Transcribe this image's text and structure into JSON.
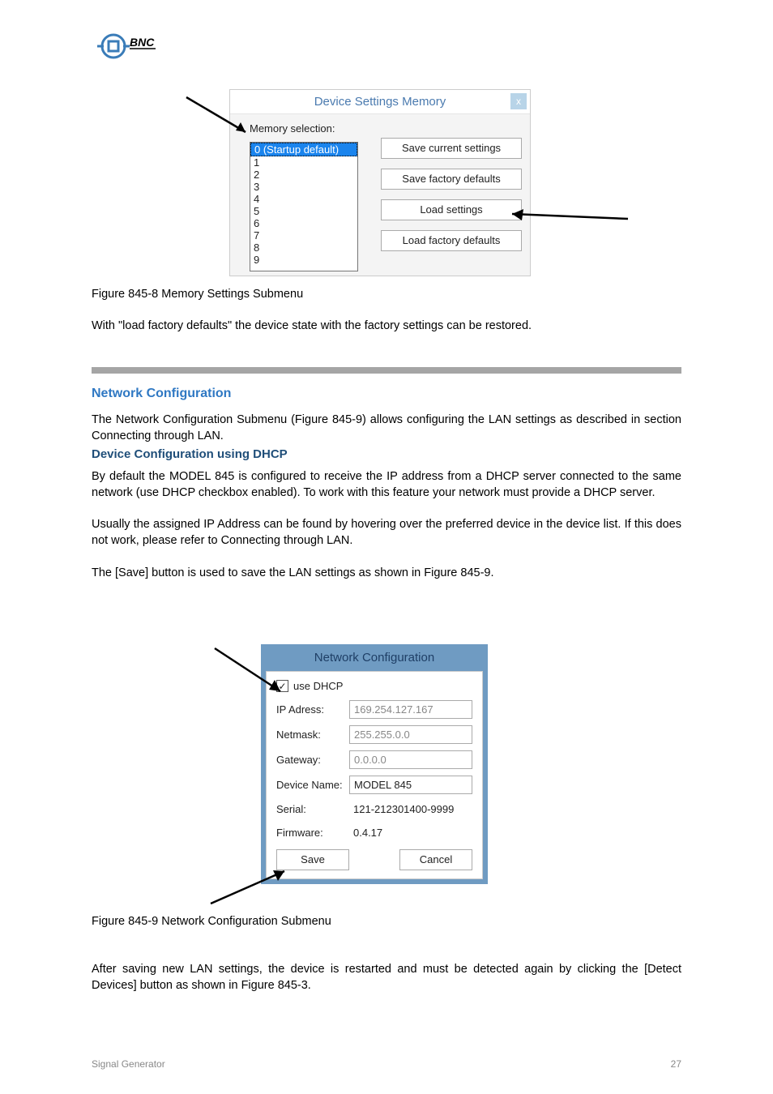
{
  "logo_text": "BNC",
  "dialog1": {
    "title": "Device Settings Memory",
    "close": "x",
    "mem_label": "Memory selection:",
    "items": [
      "0 (Startup default)",
      "1",
      "2",
      "3",
      "4",
      "5",
      "6",
      "7",
      "8",
      "9"
    ],
    "btn_save_current": "Save current settings",
    "btn_save_factory": "Save factory defaults",
    "btn_load": "Load settings",
    "btn_load_factory": "Load factory defaults"
  },
  "body": {
    "p1": "Figure 845-8 Memory Settings Submenu",
    "p2": "With \"load factory defaults\" the device state with the factory settings can be restored.",
    "section_title": "Network Configuration",
    "pA": "The Network Configuration Submenu (Figure 845-9) allows configuring the LAN settings as described in section Connecting through LAN.",
    "sub1": "Device Configuration using DHCP",
    "pB": "By default the MODEL 845 is configured to receive the IP address from a DHCP server connected to the same network (use DHCP checkbox enabled). To work with this feature your network must provide a DHCP server.",
    "pC": "Usually the assigned IP Address can be found by hovering over the preferred device in the device list. If this does not work, please refer to  Connecting through LAN.",
    "pD": "The [Save] button is used to save the LAN settings as shown in Figure 845-9.",
    "pE": "Figure 845-9 Network Configuration Submenu",
    "pF": "After saving new LAN settings, the device is restarted and must be detected again by clicking the [Detect Devices] button as shown in Figure 845-3."
  },
  "dialog2": {
    "title": "Network Configuration",
    "use_dhcp_label": "use DHCP",
    "use_dhcp_checked": true,
    "ip_label": "IP Adress:",
    "ip_value": "169.254.127.167",
    "netmask_label": "Netmask:",
    "netmask_value": "255.255.0.0",
    "gateway_label": "Gateway:",
    "gateway_value": "0.0.0.0",
    "devname_label": "Device Name:",
    "devname_value": "MODEL 845",
    "serial_label": "Serial:",
    "serial_value": "121-212301400-9999",
    "fw_label": "Firmware:",
    "fw_value": "0.4.17",
    "btn_save": "Save",
    "btn_cancel": "Cancel"
  },
  "footer": {
    "left": "Signal Generator",
    "right": "27"
  }
}
